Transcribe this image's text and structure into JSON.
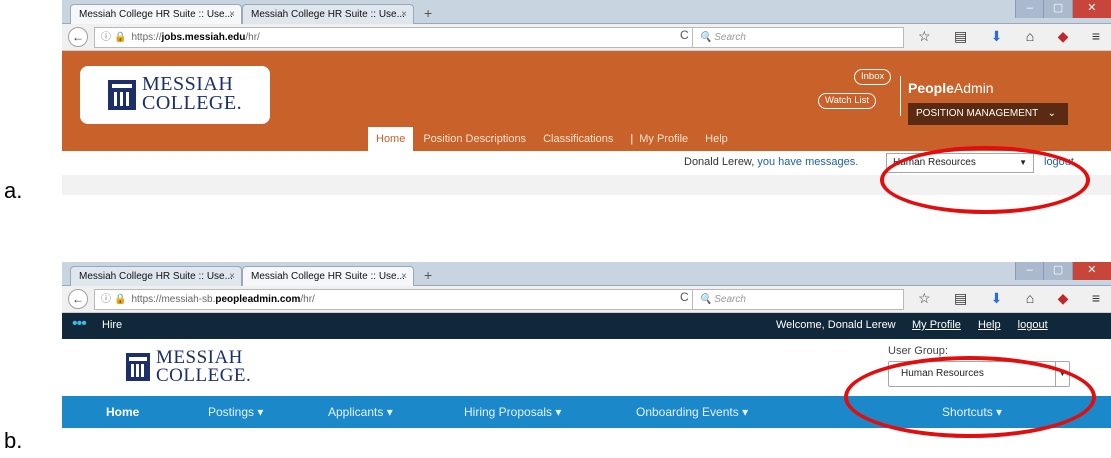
{
  "labels": {
    "a": "a.",
    "b": "b."
  },
  "window_controls": {
    "minimize": "–",
    "maximize": "▢",
    "close": "✕"
  },
  "colors": {
    "hr_orange": "#c8612a",
    "peopleadmin_dark": "#10283a",
    "hire_blue": "#1a88c9",
    "highlight_red": "#e30d0d",
    "messiah_navy": "#1c2f6b"
  },
  "screenshot_a": {
    "tabs": [
      {
        "label": "Messiah College HR Suite :: Use...",
        "close": "×"
      },
      {
        "label": "Messiah College HR Suite :: Use...",
        "close": "×"
      }
    ],
    "new_tab": "+",
    "url": {
      "scheme": "https://",
      "host": "jobs.messiah.edu",
      "path": "/hr/"
    },
    "search_placeholder": "Search",
    "logo": {
      "line1": "MESSIAH",
      "line2": "COLLEGE."
    },
    "inbox": "Inbox",
    "watch_list": "Watch List",
    "brand": {
      "bold": "People",
      "light": "Admin"
    },
    "module_select": "POSITION MANAGEMENT",
    "nav": [
      "Home",
      "Position Descriptions",
      "Classifications",
      "|",
      "My Profile",
      "Help"
    ],
    "greeting": {
      "name": "Donald Lerew,",
      "text": "you have",
      "messages": "messages."
    },
    "user_group": "Human Resources",
    "logout": "logout"
  },
  "screenshot_b": {
    "tabs": [
      {
        "label": "Messiah College HR Suite :: Use...",
        "close": "×"
      },
      {
        "label": "Messiah College HR Suite :: Use...",
        "close": "×"
      }
    ],
    "new_tab": "+",
    "url": {
      "scheme": "https://",
      "subdomain": "messiah-sb.",
      "host": "peopleadmin.com",
      "path": "/hr/"
    },
    "search_placeholder": "Search",
    "module": "Hire",
    "welcome": "Welcome, Donald Lerew",
    "top_links": [
      "My Profile",
      "Help"
    ],
    "logout": "logout",
    "logo": {
      "line1": "MESSIAH",
      "line2": "COLLEGE."
    },
    "user_group_label": "User Group:",
    "user_group": "Human Resources",
    "nav": [
      "Home",
      "Postings ▾",
      "Applicants ▾",
      "Hiring Proposals ▾",
      "Onboarding Events ▾",
      "Shortcuts ▾"
    ]
  }
}
